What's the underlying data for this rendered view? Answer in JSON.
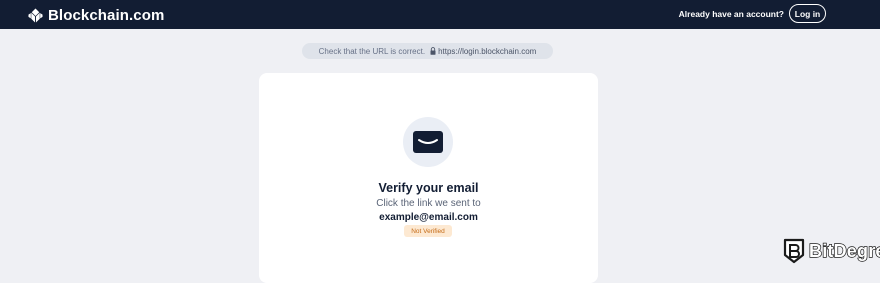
{
  "header": {
    "brand": "Blockchain.com",
    "account_prompt": "Already have an account?",
    "login_label": "Log in"
  },
  "url_notice": {
    "message": "Check that the URL is correct.",
    "url": "https://login.blockchain.com"
  },
  "verify": {
    "icon": "envelope-icon",
    "title": "Verify your email",
    "subtitle": "Click the link we sent to",
    "email": "example@email.com",
    "status_badge": "Not Verified"
  },
  "watermark": {
    "text": "BitDegree"
  },
  "colors": {
    "header_bg": "#121d33",
    "page_bg": "#eff0f4",
    "badge_bg": "#fde9d2",
    "badge_text": "#c56b17"
  }
}
